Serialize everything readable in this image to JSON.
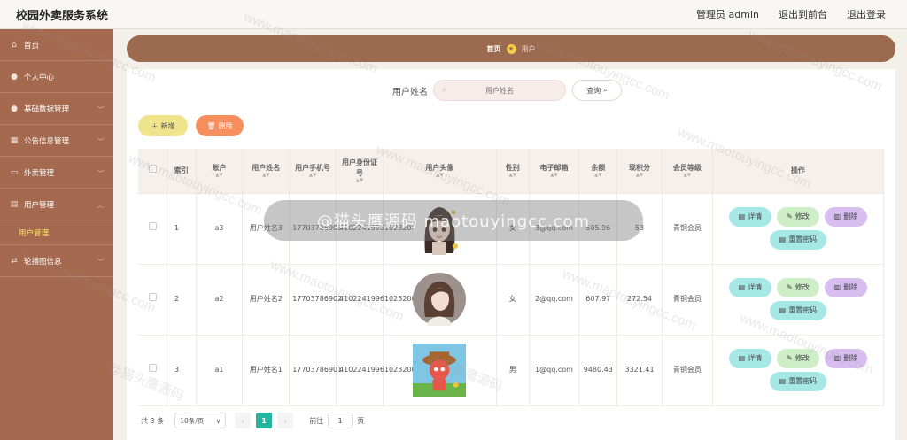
{
  "app": {
    "title": "校园外卖服务系统",
    "user_label": "管理员 admin",
    "to_front": "退出到前台",
    "logout": "退出登录"
  },
  "sidebar": {
    "items": [
      {
        "label": "首页",
        "icon": "home-icon"
      },
      {
        "label": "个人中心",
        "icon": "user-icon"
      },
      {
        "label": "基础数据管理",
        "icon": "user-icon"
      },
      {
        "label": "公告信息管理",
        "icon": "grid-icon"
      },
      {
        "label": "外卖管理",
        "icon": "doc-icon"
      },
      {
        "label": "用户管理",
        "icon": "table-icon"
      },
      {
        "label": "轮播图信息",
        "icon": "swap-icon"
      }
    ],
    "active_sub": "用户管理"
  },
  "breadcrumb": {
    "home": "首页",
    "current": "用户"
  },
  "search": {
    "label": "用户姓名",
    "placeholder": "用户姓名",
    "button": "查询"
  },
  "actions": {
    "add": "新增",
    "delete": "删除"
  },
  "table": {
    "headers": [
      "索引",
      "账户",
      "用户姓名",
      "用户手机号",
      "用户身份证号",
      "用户头像",
      "性别",
      "电子邮箱",
      "余额",
      "现积分",
      "会员等级",
      "操作"
    ],
    "rows": [
      {
        "index": "1",
        "account": "a3",
        "name": "用户姓名3",
        "phone": "17703786903",
        "idcard": "410224199610232003",
        "avatar": "anime-girl",
        "gender": "女",
        "email": "3@qq.com",
        "balance": "505.96",
        "points": "53",
        "level": "青铜会员"
      },
      {
        "index": "2",
        "account": "a2",
        "name": "用户姓名2",
        "phone": "17703786902",
        "idcard": "410224199610232002",
        "avatar": "woman-portrait",
        "gender": "女",
        "email": "2@qq.com",
        "balance": "607.97",
        "points": "272.54",
        "level": "青铜会员"
      },
      {
        "index": "3",
        "account": "a1",
        "name": "用户姓名1",
        "phone": "17703786901",
        "idcard": "410224199610232001",
        "avatar": "cartoon-bear",
        "gender": "男",
        "email": "1@qq.com",
        "balance": "9480.43",
        "points": "3321.41",
        "level": "青铜会员"
      }
    ],
    "ops": {
      "detail": "详情",
      "edit": "修改",
      "delete": "删除",
      "reset": "重置密码"
    }
  },
  "pagination": {
    "total": "共 3 条",
    "page_size": "10条/页",
    "current": "1",
    "goto_label": "前往",
    "goto_value": "1",
    "page_suffix": "页"
  },
  "watermark": {
    "text": "www.maotouyingcc.com",
    "cn": "@猫头鹰源码"
  },
  "overlay_text": "@猫头鹰源码  maotouyingcc.com",
  "colors": {
    "sidebar": "#a5694f",
    "accent": "#25b59f",
    "add": "#efe48c",
    "delete": "#f78e5d"
  }
}
